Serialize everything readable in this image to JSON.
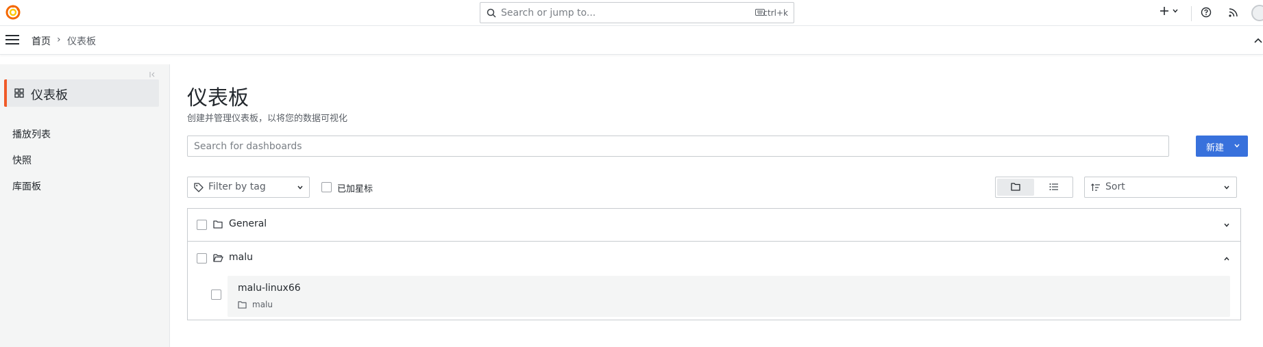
{
  "topbar": {
    "search_placeholder": "Search or jump to...",
    "search_shortcut": "ctrl+k",
    "logo_icon": "grafana-logo-icon",
    "plus_icon": "plus-icon",
    "help_icon": "help-icon",
    "news_icon": "rss-icon"
  },
  "breadcrumb": {
    "home": "首页",
    "separator": "›",
    "current": "仪表板"
  },
  "sidebar": {
    "active_label": "仪表板",
    "items": [
      {
        "label": "播放列表"
      },
      {
        "label": "快照"
      },
      {
        "label": "库面板"
      }
    ]
  },
  "main": {
    "title": "仪表板",
    "subtitle": "创建并管理仪表板，以将您的数据可视化",
    "search_placeholder": "Search for dashboards",
    "new_button": "新建",
    "tag_filter_placeholder": "Filter by tag",
    "starred_label": "已加星标",
    "sort_label": "Sort",
    "folders": [
      {
        "name": "General",
        "expanded": false
      },
      {
        "name": "malu",
        "expanded": true
      }
    ],
    "dashboards": [
      {
        "title": "malu-linux66",
        "folder": "malu"
      }
    ]
  },
  "colors": {
    "accent": "#3871dc",
    "active_indicator": "#f05a28"
  }
}
